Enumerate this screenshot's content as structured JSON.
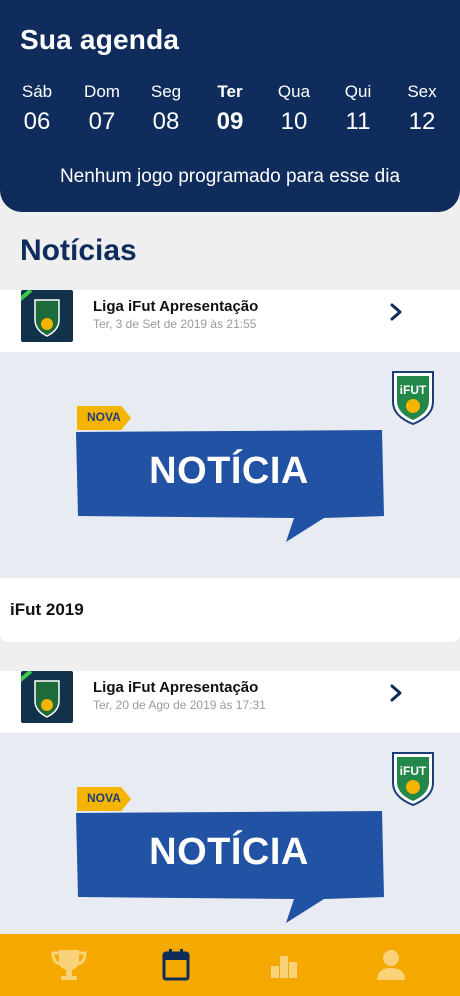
{
  "agenda": {
    "title": "Sua agenda",
    "days": [
      {
        "name": "Sáb",
        "num": "06"
      },
      {
        "name": "Dom",
        "num": "07"
      },
      {
        "name": "Seg",
        "num": "08"
      },
      {
        "name": "Ter",
        "num": "09"
      },
      {
        "name": "Qua",
        "num": "10"
      },
      {
        "name": "Qui",
        "num": "11"
      },
      {
        "name": "Sex",
        "num": "12"
      }
    ],
    "selected_day": "Ter",
    "empty_message": "Nenhum jogo programado para esse dia"
  },
  "news": {
    "section_title": "Notícias",
    "cards": [
      {
        "source": "Liga iFut Apresentação",
        "date": "Ter, 3 de Set de 2019 às 21:55",
        "badge": "NOVA",
        "banner_text": "NOTÍCIA",
        "logo_text": "iFUT",
        "title": "iFut 2019"
      },
      {
        "source": "Liga iFut Apresentação",
        "date": "Ter, 20 de Ago de 2019 às 17:31",
        "badge": "NOVA",
        "banner_text": "NOTÍCIA",
        "logo_text": "iFUT"
      }
    ]
  },
  "bottom_nav": {
    "items": [
      {
        "icon": "trophy-icon"
      },
      {
        "icon": "calendar-icon",
        "active": true
      },
      {
        "icon": "ranking-icon"
      },
      {
        "icon": "user-icon"
      }
    ]
  },
  "colors": {
    "primary": "#0f2c5c",
    "accent": "#f5a800",
    "banner_blue": "#2152a3",
    "badge_yellow": "#f4b400"
  }
}
